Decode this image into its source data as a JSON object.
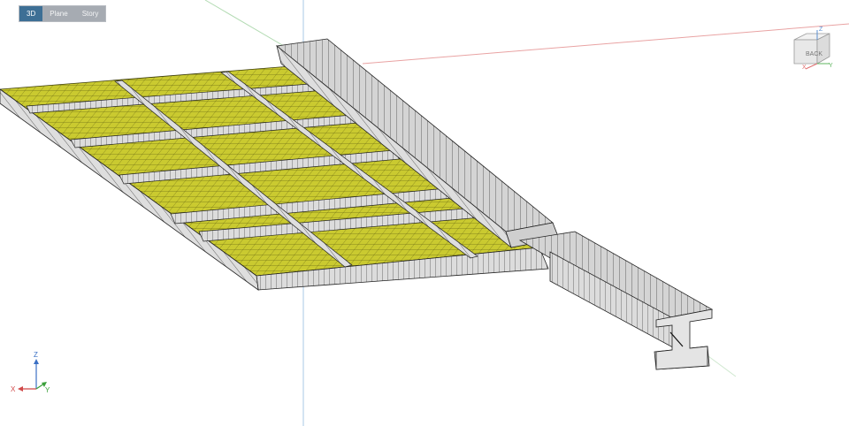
{
  "view_tabs": [
    {
      "label": "3D",
      "active": true
    },
    {
      "label": "Plane",
      "active": false
    },
    {
      "label": "Story",
      "active": false
    }
  ],
  "view_cube": {
    "face_label": "BACK",
    "axis_z": "Z",
    "axis_x": "X",
    "axis_y": "Y"
  },
  "axis_triad": {
    "z": "Z",
    "x": "X",
    "y": "Y"
  },
  "colors": {
    "deck_fill": "#c9c92f",
    "steel_fill": "#d9d9d9",
    "edge": "#2a2a2a",
    "axis_x": "#e8a0a0",
    "axis_y": "#a8d8a8",
    "axis_z": "#9cc0e0",
    "tab_active": "#3d6f95"
  }
}
